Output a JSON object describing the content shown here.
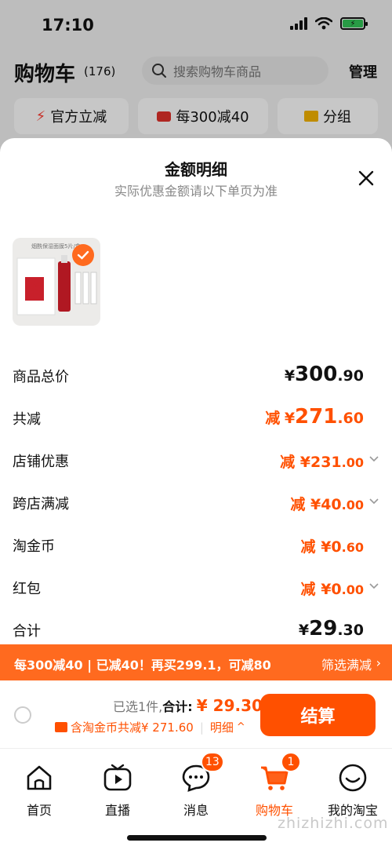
{
  "status_bar": {
    "time": "17:10",
    "battery_icon": "battery-charging-icon"
  },
  "cart_header": {
    "title": "购物车",
    "count": "(176)",
    "search_placeholder": "搜索购物车商品",
    "manage": "管理"
  },
  "chips": [
    {
      "label": "官方立减",
      "icon": "lightning-icon"
    },
    {
      "label": "每300减40",
      "icon": "coupon-icon"
    },
    {
      "label": "分组",
      "icon": "folder-icon"
    }
  ],
  "sheet": {
    "title": "金额明细",
    "subtitle": "实际优惠金额请以下单页为准"
  },
  "product": {
    "pack_text": "烟酰保湿面膜5片/盒",
    "brand_glyph": "润"
  },
  "breakdown": {
    "total_price": {
      "label": "商品总价",
      "yen": "¥",
      "int": "300",
      "dec": ".90"
    },
    "total_reduce": {
      "label": "共减",
      "prefix": "减",
      "yen": "¥",
      "int": "271",
      "dec": ".60"
    },
    "shop_discount": {
      "label": "店铺优惠",
      "prefix": "减",
      "yen": "¥",
      "int": "231",
      "dec": ".00"
    },
    "cross_shop": {
      "label": "跨店满减",
      "prefix": "减",
      "yen": "¥",
      "int": "40",
      "dec": ".00"
    },
    "taobao_coin": {
      "label": "淘金币",
      "prefix": "减",
      "yen": "¥",
      "int": "0",
      "dec": ".60"
    },
    "red_packet": {
      "label": "红包",
      "prefix": "减",
      "yen": "¥",
      "int": "0",
      "dec": ".00"
    },
    "sum": {
      "label": "合计",
      "yen": "¥",
      "int": "29",
      "dec": ".30"
    }
  },
  "promo": {
    "text": "每300减40 | 已减40！再买299.1，可减80",
    "filter": "筛选满减",
    "arrow": "›"
  },
  "checkout": {
    "selected": "已选1件,",
    "total_label": "合计:",
    "total_value": "¥ 29.30",
    "coin_text": "含淘金币共减¥ 271.60",
    "detail": "明细",
    "detail_arrow": "^",
    "pay_label": "结算"
  },
  "tabs": [
    {
      "label": "首页",
      "icon": "home-icon"
    },
    {
      "label": "直播",
      "icon": "live-play-icon"
    },
    {
      "label": "消息",
      "icon": "message-bubble-icon",
      "badge": "13"
    },
    {
      "label": "购物车",
      "icon": "cart-icon",
      "badge": "1"
    },
    {
      "label": "我的淘宝",
      "icon": "smile-face-icon"
    }
  ],
  "watermark": "zhizhizhi.com",
  "colors": {
    "accent": "#ff5000",
    "promo_bar": "#ff6a1f"
  }
}
